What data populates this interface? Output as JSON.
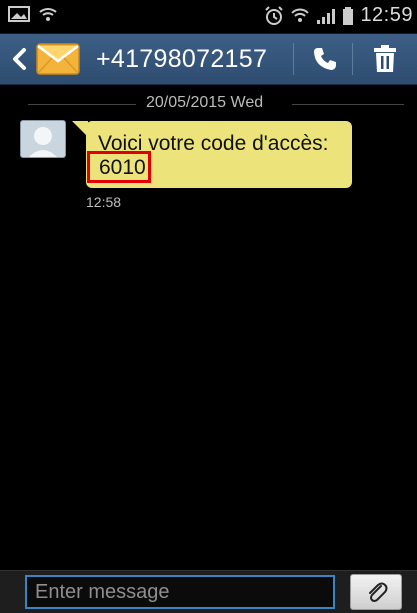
{
  "status_bar": {
    "time": "12:59",
    "icons": [
      "image-icon",
      "wifi-icon",
      "alarm-icon",
      "wifi-icon",
      "signal-icon",
      "battery-icon"
    ]
  },
  "action_bar": {
    "contact": "+41798072157",
    "icons": [
      "back-arrow-icon",
      "envelope-icon",
      "phone-icon",
      "trash-icon"
    ]
  },
  "conversation": {
    "date": "20/05/2015 Wed",
    "messages": [
      {
        "text": "Voici votre code d'accès:",
        "code": "6010",
        "time": "12:58"
      }
    ]
  },
  "composer": {
    "placeholder": "Enter message",
    "attach_icon": "paperclip-icon"
  },
  "colors": {
    "action_bar": "#2e4c70",
    "bubble": "#ece47a",
    "highlight": "#e00000",
    "input_border": "#3b84c4"
  }
}
